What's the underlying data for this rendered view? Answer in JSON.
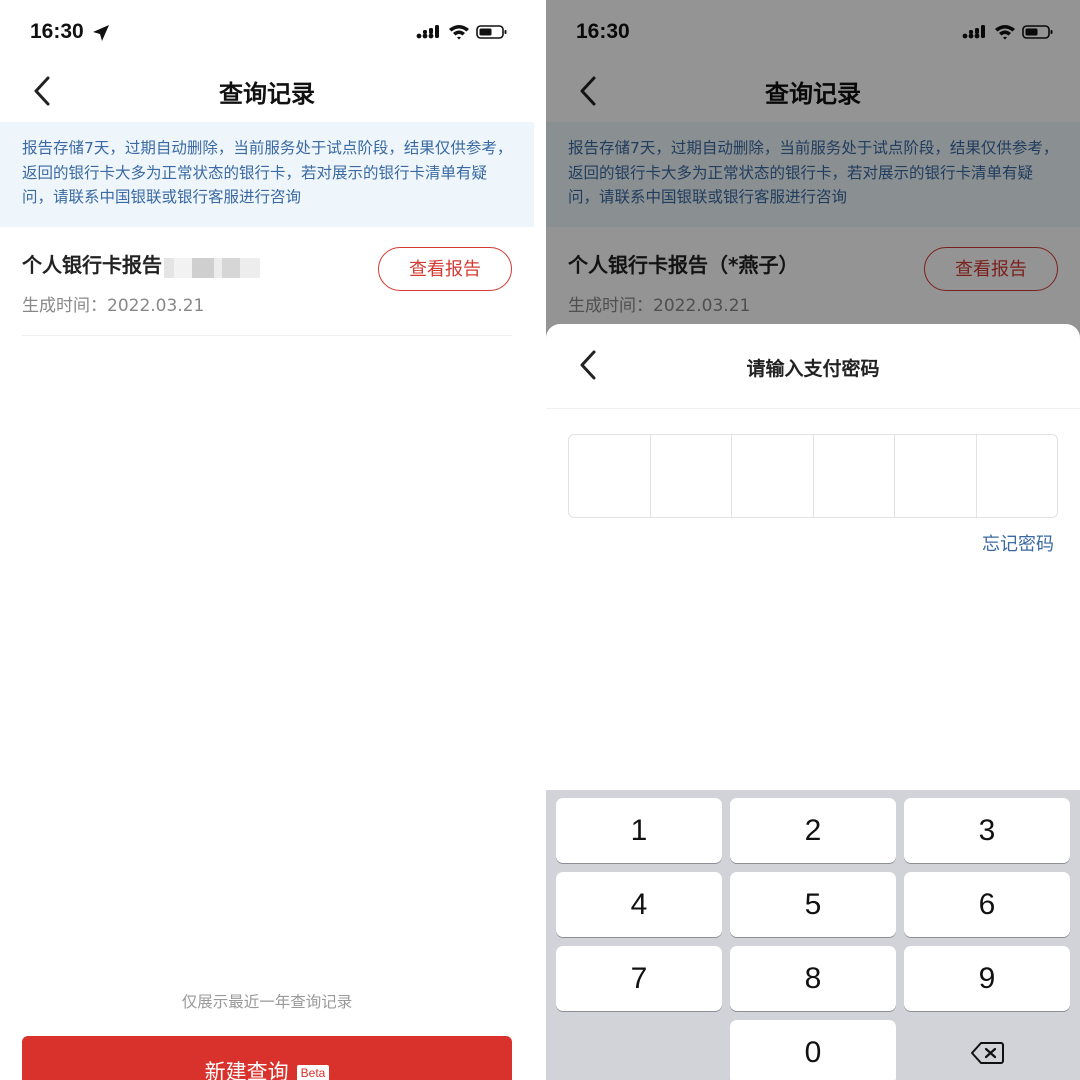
{
  "left": {
    "status": {
      "time": "16:30"
    },
    "nav": {
      "title": "查询记录"
    },
    "notice": "报告存储7天，过期自动删除，当前服务处于试点阶段，结果仅供参考，返回的银行卡大多为正常状态的银行卡，若对展示的银行卡清单有疑问，请联系中国银联或银行客服进行咨询",
    "record": {
      "title": "个人银行卡报告",
      "time": "生成时间：2022.03.21",
      "button": "查看报告"
    },
    "footnote": "仅展示最近一年查询记录",
    "new_button": {
      "label": "新建查询",
      "badge": "Beta"
    }
  },
  "right": {
    "status": {
      "time": "16:30"
    },
    "nav": {
      "title": "查询记录"
    },
    "notice": "报告存储7天，过期自动删除，当前服务处于试点阶段，结果仅供参考，返回的银行卡大多为正常状态的银行卡，若对展示的银行卡清单有疑问，请联系中国银联或银行客服进行咨询",
    "record": {
      "title": "个人银行卡报告（*燕子）",
      "time": "生成时间：2022.03.21",
      "button": "查看报告"
    },
    "sheet": {
      "title": "请输入支付密码",
      "forgot": "忘记密码"
    },
    "keypad": {
      "k1": "1",
      "k2": "2",
      "k3": "3",
      "k4": "4",
      "k5": "5",
      "k6": "6",
      "k7": "7",
      "k8": "8",
      "k9": "9",
      "k0": "0",
      "delete_icon": "backspace-icon"
    }
  },
  "colors": {
    "brand_red": "#d9312b",
    "notice_blue": "#3a69a3",
    "notice_bg": "#eef6fb"
  }
}
